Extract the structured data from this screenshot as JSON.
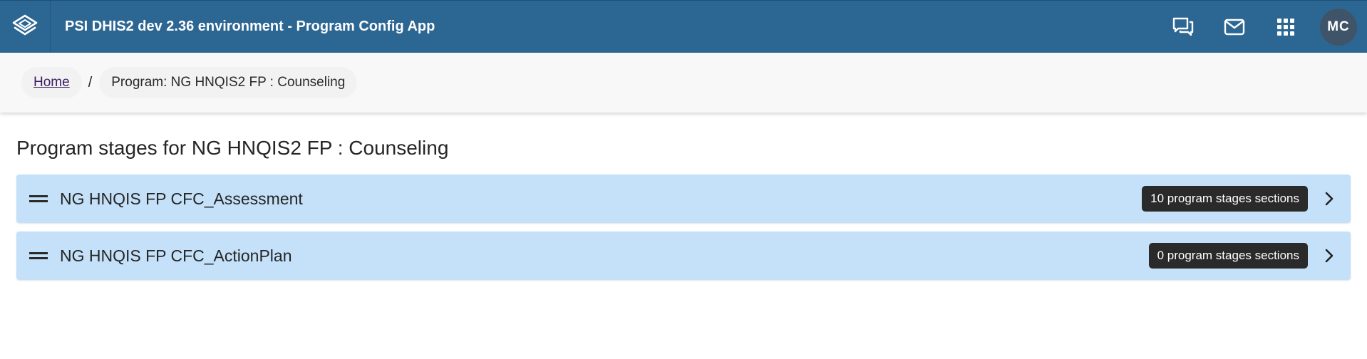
{
  "header": {
    "app_title": "PSI DHIS2 dev 2.36 environment - Program Config App",
    "icons": [
      "logo-icon",
      "interpretations-icon",
      "messages-icon",
      "apps-grid-icon"
    ],
    "avatar_initials": "MC",
    "bar_color": "#2c6693"
  },
  "breadcrumb": {
    "home": "Home",
    "separator": "/",
    "current": "Program: NG HNQIS2 FP : Counseling"
  },
  "page_title": "Program stages for NG HNQIS2 FP : Counseling",
  "stages": [
    {
      "name": "NG HNQIS FP CFC_Assessment",
      "badge": "10 program stages sections"
    },
    {
      "name": "NG HNQIS FP CFC_ActionPlan",
      "badge": "0 program stages sections"
    }
  ],
  "colors": {
    "row_background": "#c4e1f9",
    "badge_background": "#2a2a2a"
  }
}
